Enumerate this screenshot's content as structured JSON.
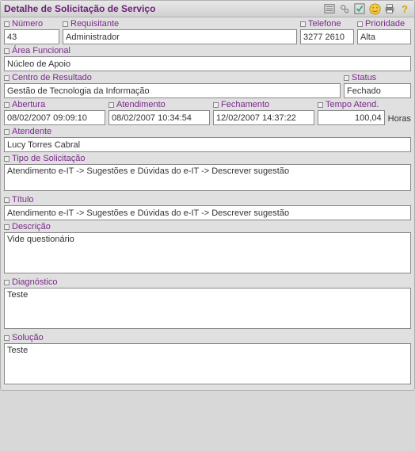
{
  "header": {
    "title": "Detalhe de Solicitação de Serviço"
  },
  "labels": {
    "numero": "Número",
    "requisitante": "Requisitante",
    "telefone": "Telefone",
    "prioridade": "Prioridade",
    "area_funcional": "Área Funcional",
    "centro_resultado": "Centro de Resultado",
    "status": "Status",
    "abertura": "Abertura",
    "atendimento": "Atendimento",
    "fechamento": "Fechamento",
    "tempo_atend": "Tempo Atend.",
    "tempo_unit": "Horas",
    "atendente": "Atendente",
    "tipo_solicitacao": "Tipo de Solicitação",
    "titulo": "Título",
    "descricao": "Descrição",
    "diagnostico": "Diagnóstico",
    "solucao": "Solução"
  },
  "values": {
    "numero": "43",
    "requisitante": "Administrador",
    "telefone": "3277 2610",
    "prioridade": "Alta",
    "area_funcional": "Núcleo de Apoio",
    "centro_resultado": "Gestão de Tecnologia da Informação",
    "status": "Fechado",
    "abertura": "08/02/2007 09:09:10",
    "atendimento": "08/02/2007 10:34:54",
    "fechamento": "12/02/2007 14:37:22",
    "tempo_atend": "100,04",
    "atendente": "Lucy Torres Cabral",
    "tipo_solicitacao": "Atendimento e-IT -> Sugestões e Dúvidas do e-IT -> Descrever sugestão",
    "titulo": "Atendimento e-IT -> Sugestões e Dúvidas do e-IT -> Descrever sugestão",
    "descricao": "Vide questionário",
    "diagnostico": "Teste",
    "solucao": "Teste"
  }
}
